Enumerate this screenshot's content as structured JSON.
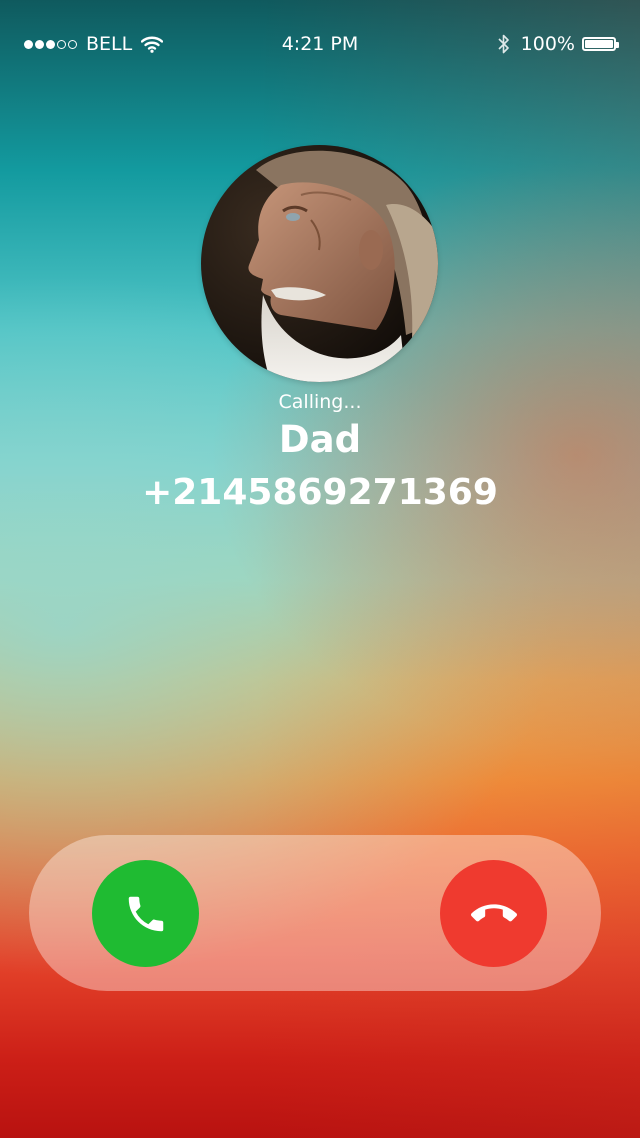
{
  "status_bar": {
    "carrier": "BELL",
    "signal_strength": 3,
    "signal_max": 5,
    "time": "4:21 PM",
    "battery": "100%",
    "battery_level": 1.0,
    "icons": [
      "signal-dots",
      "wifi-icon",
      "bluetooth-icon",
      "battery-icon"
    ]
  },
  "call": {
    "status": "Calling...",
    "contact_name": "Dad",
    "phone_number": "+2145869271369"
  },
  "controls": {
    "accept_icon": "phone-icon",
    "decline_icon": "hang-up-icon",
    "accept_color": "#1fbb32",
    "decline_color": "#ef3a2f"
  }
}
